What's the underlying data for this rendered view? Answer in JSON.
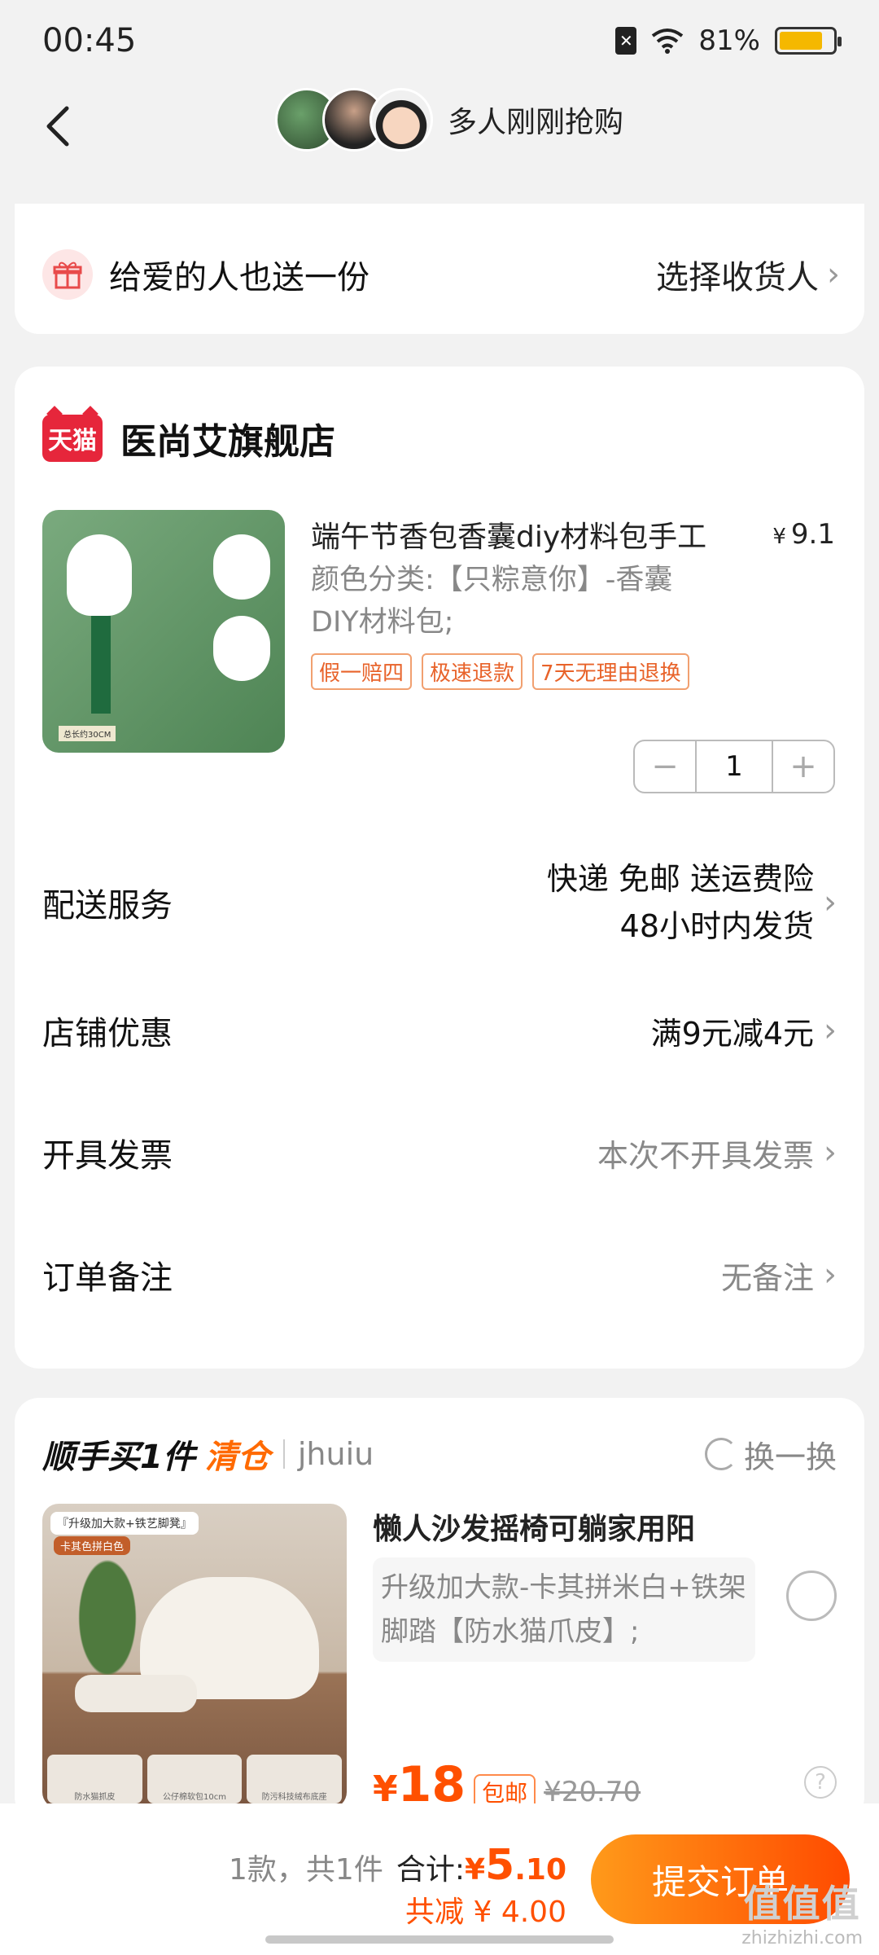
{
  "status": {
    "time": "00:45",
    "battery": "81%",
    "battery_level": 0.81
  },
  "nav": {
    "title": "多人刚刚抢购"
  },
  "gift": {
    "text": "给爱的人也送一份",
    "action": "选择收货人"
  },
  "shop": {
    "logo": "天猫",
    "name": "医尚艾旗舰店"
  },
  "product": {
    "title": "端午节香包香囊diy材料包手工",
    "price_symbol": "¥",
    "price": "9.1",
    "spec_line1": "颜色分类:【只粽意你】-香囊",
    "spec_line2": "DIY材料包;",
    "tags": [
      "假一赔四",
      "极速退款",
      "7天无理由退换"
    ],
    "quantity": "1",
    "minus": "−",
    "plus": "+",
    "image_caption": "总长约30CM"
  },
  "rows": {
    "shipping": {
      "label": "配送服务",
      "line1": "快递 免邮 送运费险",
      "line2": "48小时内发货"
    },
    "discount": {
      "label": "店铺优惠",
      "value": "满9元减4元"
    },
    "invoice": {
      "label": "开具发票",
      "value": "本次不开具发票"
    },
    "note": {
      "label": "订单备注",
      "value": "无备注"
    }
  },
  "addon": {
    "title1": "顺手买1件",
    "title2": "清仓",
    "user": "jhuiu",
    "swap": "换一换",
    "product_title": "懒人沙发摇椅可躺家用阳",
    "spec": "升级加大款-卡其拼米白+铁架脚踏【防水猫爪皮】;",
    "price_symbol": "¥",
    "price": "18",
    "free_shipping": "包邮",
    "original_price": "¥20.70",
    "image_banner": "『升级加大款+铁艺脚凳』",
    "image_banner2": "卡其色拼白色",
    "image_swatches": [
      "防水猫抓皮",
      "公仔棉软包10cm",
      "防污科技绒布底座"
    ]
  },
  "footer": {
    "count": "1款，共1件",
    "total_label": "合计:",
    "total_symbol": "¥",
    "total_int": "5",
    "total_dec": ".10",
    "saved": "共减 ¥ 4.00",
    "submit": "提交订单",
    "watermark": "值值值",
    "watermark_url": "zhizhizhi.com"
  }
}
